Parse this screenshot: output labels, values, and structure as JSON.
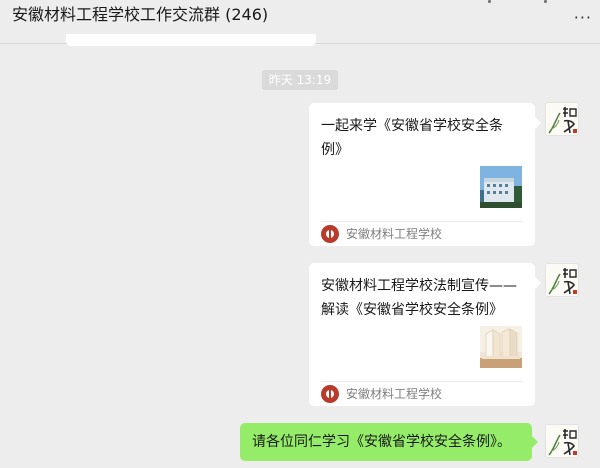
{
  "header": {
    "group_name": "安徽材料工程学校工作交流群 (246)",
    "more_icon": "ellipsis-icon",
    "more_glyph": "···"
  },
  "chat": {
    "timestamp": "昨天 13:19",
    "messages": [
      {
        "type": "link-card",
        "title": "一起来学《安徽省学校安全条例》",
        "thumbnail": "campus-building-image",
        "source": "安徽材料工程学校",
        "source_logo": "school-emblem-icon",
        "sender_avatar": "calligraphy-avatar"
      },
      {
        "type": "link-card",
        "title": "安徽材料工程学校法制宣传——解读《安徽省学校安全条例》",
        "thumbnail": "open-book-image",
        "source": "安徽材料工程学校",
        "source_logo": "school-emblem-icon",
        "sender_avatar": "calligraphy-avatar"
      },
      {
        "type": "text",
        "text": "请各位同仁学习《安徽省学校安全条例》。",
        "bubble_color": "#95ec69",
        "sender_avatar": "calligraphy-avatar"
      }
    ]
  },
  "colors": {
    "background": "#ededed",
    "card": "#ffffff",
    "self_bubble": "#95ec69",
    "source_text": "#7f7f7f",
    "emblem": "#b73a2b"
  }
}
